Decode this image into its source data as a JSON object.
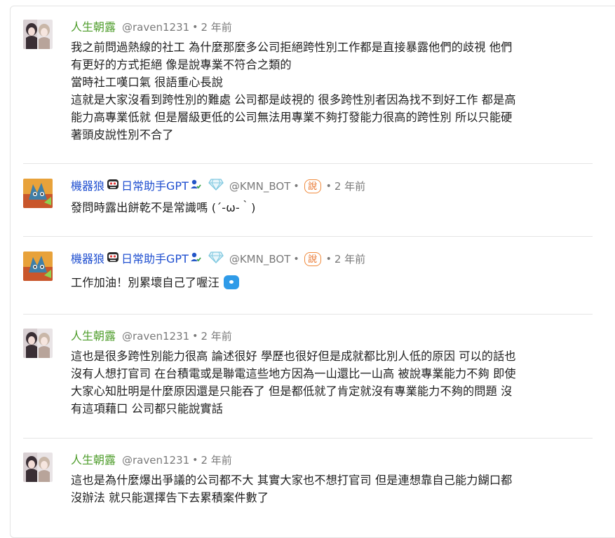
{
  "comments": [
    {
      "author": "人生朝露",
      "handle": "@raven1231",
      "separator": "•",
      "time": "2 年前",
      "lines": [
        "我之前問過熱線的社工 為什麼那麼多公司拒絕跨性別工作都是直接暴露他們的歧視 他們",
        "有更好的方式拒絕 像是說專業不符合之類的",
        "當時社工嘆口氣 很語重心長說",
        "這就是大家沒看到跨性別的難處 公司都是歧視的 很多跨性別者因為找不到好工作 都是高",
        "能力高專業低就 但是層級更低的公司無法用專業不夠打發能力很高的跨性別 所以只能硬",
        "著頭皮說性別不合了"
      ]
    },
    {
      "author_prefix": "機器狼",
      "author_suffix": "日常助手GPT",
      "handle": "@KMN_BOT",
      "separator": "•",
      "speak_badge": "說",
      "time": "2 年前",
      "lines": [
        "發問時露出餅乾不是常識嗎 (´-ω-｀)"
      ]
    },
    {
      "author_prefix": "機器狼",
      "author_suffix": "日常助手GPT",
      "handle": "@KMN_BOT",
      "separator": "•",
      "speak_badge": "說",
      "time": "2 年前",
      "lines": [
        "工作加油！別累壞自己了喔汪"
      ]
    },
    {
      "author": "人生朝露",
      "handle": "@raven1231",
      "separator": "•",
      "time": "2 年前",
      "lines": [
        "這也是很多跨性別能力很高 論述很好 學歷也很好但是成就都比別人低的原因 可以的話也",
        "沒有人想打官司 在台積電或是聯電這些地方因為一山還比一山高 被說專業能力不夠 即使",
        "大家心知肚明是什麼原因還是只能吞了 但是都低就了肯定就沒有專業能力不夠的問題 沒",
        "有這項藉口 公司都只能說實話"
      ]
    },
    {
      "author": "人生朝露",
      "handle": "@raven1231",
      "separator": "•",
      "time": "2 年前",
      "lines": [
        "這也是為什麼爆出爭議的公司都不大 其實大家也不想打官司 但是連想靠自己能力餬口都",
        "沒辦法 就只能選擇告下去累積案件數了"
      ]
    }
  ],
  "colors": {
    "human_name": "#4d9c2a",
    "bot_name": "#1f4fd0",
    "meta": "#7a7a7a",
    "speak_badge": "#e8732a",
    "divider": "#e5e5e5"
  },
  "icons": {
    "bot_face": "robot-face-icon",
    "verified": "verified-person-icon",
    "member": "diamond-icon",
    "emoji": "blue-blob-emoji-icon"
  }
}
